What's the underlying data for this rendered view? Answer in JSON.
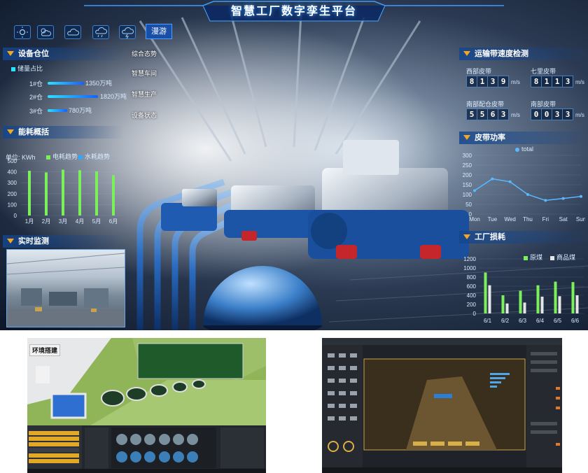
{
  "dashboard": {
    "title": "智慧工厂数字孪生平台",
    "weather_icons": [
      "sun-icon",
      "partly-cloudy-icon",
      "cloud-icon",
      "rain-cloud-icon",
      "thunder-cloud-icon"
    ],
    "roam_label": "漫游",
    "menu": [
      "综合态势",
      "智慧车间",
      "智慧生产",
      "设备状态"
    ],
    "warehouse": {
      "title": "设备仓位",
      "legend": "储量占比",
      "rows": [
        {
          "label": "1#仓",
          "value": "1350万吨",
          "ratio": 1.0
        },
        {
          "label": "2#仓",
          "value": "1820万吨",
          "ratio": 0.95
        },
        {
          "label": "3#仓",
          "value": "780万吨",
          "ratio": 0.4
        }
      ]
    },
    "energy": {
      "title": "能耗概括",
      "unit": "单位: KWh",
      "legend_a": "电耗趋势",
      "legend_b": "水耗趋势"
    },
    "monitor": {
      "title": "实时监测"
    },
    "conveyor": {
      "title": "运输带速度检测",
      "units": [
        "m/s",
        "m/s",
        "m/s",
        "m/s"
      ],
      "items": [
        {
          "label": "西部皮带",
          "digits": [
            "8",
            "1",
            "3",
            "9"
          ]
        },
        {
          "label": "七里皮带",
          "digits": [
            "8",
            "1",
            "1",
            "3"
          ]
        },
        {
          "label": "南部配仓皮带",
          "digits": [
            "5",
            "5",
            "6",
            "3"
          ]
        },
        {
          "label": "南部皮带",
          "digits": [
            "0",
            "0",
            "3",
            "3"
          ]
        }
      ]
    },
    "belt_power": {
      "title": "皮带功率",
      "legend": "total"
    },
    "loss": {
      "title": "工厂损耗",
      "legend_a": "原煤",
      "legend_b": "商品煤"
    }
  },
  "chart_data": [
    {
      "type": "bar",
      "categories": [
        "1月",
        "2月",
        "3月",
        "4月",
        "5月",
        "6月"
      ],
      "series": [
        {
          "name": "电耗趋势",
          "values": [
            410,
            395,
            420,
            415,
            405,
            370
          ]
        }
      ],
      "ylabel": "单位: KWh",
      "ylim": [
        0,
        500
      ],
      "yticks": [
        0,
        100,
        200,
        300,
        400,
        500
      ],
      "legend": "top"
    },
    {
      "type": "line",
      "categories": [
        "Mon",
        "Tue",
        "Wed",
        "Thu",
        "Fri",
        "Sat",
        "Sun"
      ],
      "series": [
        {
          "name": "total",
          "values": [
            120,
            180,
            165,
            100,
            70,
            80,
            90
          ]
        }
      ],
      "ylim": [
        0,
        300
      ],
      "yticks": [
        0,
        50,
        100,
        150,
        200,
        250,
        300
      ],
      "legend": "top"
    },
    {
      "type": "bar",
      "categories": [
        "6/1",
        "6/2",
        "6/3",
        "6/4",
        "6/5",
        "6/6"
      ],
      "series": [
        {
          "name": "原煤",
          "values": [
            900,
            400,
            500,
            620,
            700,
            690
          ]
        },
        {
          "name": "商品煤",
          "values": [
            620,
            220,
            240,
            370,
            380,
            400
          ]
        }
      ],
      "ylim": [
        0,
        1200
      ],
      "yticks": [
        0,
        200,
        400,
        600,
        800,
        1000,
        1200
      ],
      "legend": "top-right"
    }
  ],
  "editor_left": {
    "label": "环境搭建"
  }
}
